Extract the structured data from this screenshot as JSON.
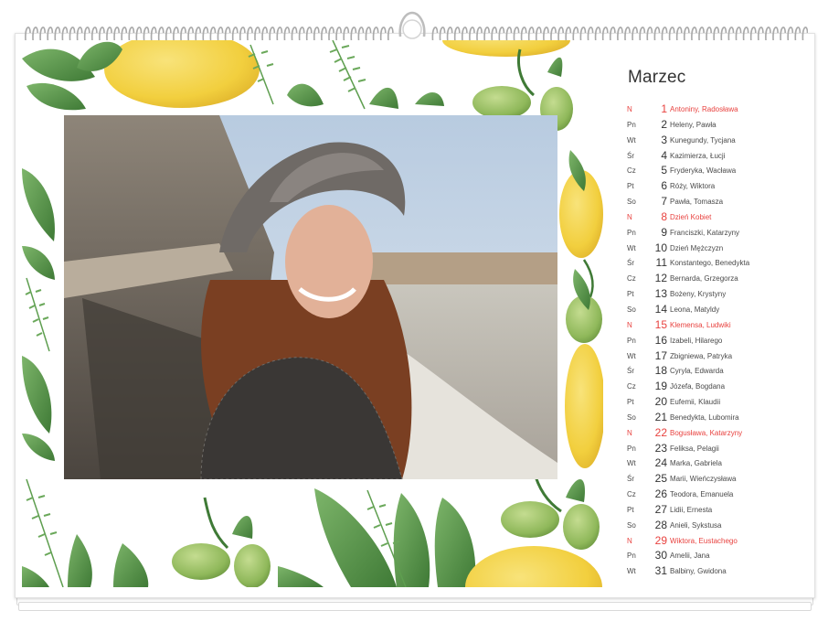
{
  "calendar": {
    "month": "Marzec",
    "colors": {
      "sunday": "#e8423f",
      "text": "#4a4a4a"
    },
    "days": [
      {
        "dow": "N",
        "num": "1",
        "names": "Antoniny, Radosława",
        "sunday": true
      },
      {
        "dow": "Pn",
        "num": "2",
        "names": "Heleny, Pawła",
        "sunday": false
      },
      {
        "dow": "Wt",
        "num": "3",
        "names": "Kunegundy, Tycjana",
        "sunday": false
      },
      {
        "dow": "Śr",
        "num": "4",
        "names": "Kazimierza, Łucji",
        "sunday": false
      },
      {
        "dow": "Cz",
        "num": "5",
        "names": "Fryderyka, Wacława",
        "sunday": false
      },
      {
        "dow": "Pt",
        "num": "6",
        "names": "Róży, Wiktora",
        "sunday": false
      },
      {
        "dow": "So",
        "num": "7",
        "names": "Pawła, Tomasza",
        "sunday": false
      },
      {
        "dow": "N",
        "num": "8",
        "names": "Dzień Kobiet",
        "sunday": true
      },
      {
        "dow": "Pn",
        "num": "9",
        "names": "Franciszki, Katarzyny",
        "sunday": false
      },
      {
        "dow": "Wt",
        "num": "10",
        "names": "Dzień Mężczyzn",
        "sunday": false
      },
      {
        "dow": "Śr",
        "num": "11",
        "names": "Konstantego, Benedykta",
        "sunday": false
      },
      {
        "dow": "Cz",
        "num": "12",
        "names": "Bernarda, Grzegorza",
        "sunday": false
      },
      {
        "dow": "Pt",
        "num": "13",
        "names": "Bożeny, Krystyny",
        "sunday": false
      },
      {
        "dow": "So",
        "num": "14",
        "names": "Leona, Matyldy",
        "sunday": false
      },
      {
        "dow": "N",
        "num": "15",
        "names": "Klemensa, Ludwiki",
        "sunday": true
      },
      {
        "dow": "Pn",
        "num": "16",
        "names": "Izabeli, Hilarego",
        "sunday": false
      },
      {
        "dow": "Wt",
        "num": "17",
        "names": "Zbigniewa, Patryka",
        "sunday": false
      },
      {
        "dow": "Śr",
        "num": "18",
        "names": "Cyryla, Edwarda",
        "sunday": false
      },
      {
        "dow": "Cz",
        "num": "19",
        "names": "Józefa, Bogdana",
        "sunday": false
      },
      {
        "dow": "Pt",
        "num": "20",
        "names": "Eufemii, Klaudii",
        "sunday": false
      },
      {
        "dow": "So",
        "num": "21",
        "names": "Benedykta, Lubomira",
        "sunday": false
      },
      {
        "dow": "N",
        "num": "22",
        "names": "Bogusława, Katarzyny",
        "sunday": true
      },
      {
        "dow": "Pn",
        "num": "23",
        "names": "Feliksa, Pelagii",
        "sunday": false
      },
      {
        "dow": "Wt",
        "num": "24",
        "names": "Marka, Gabriela",
        "sunday": false
      },
      {
        "dow": "Śr",
        "num": "25",
        "names": "Marii, Wieńczysława",
        "sunday": false
      },
      {
        "dow": "Cz",
        "num": "26",
        "names": "Teodora, Emanuela",
        "sunday": false
      },
      {
        "dow": "Pt",
        "num": "27",
        "names": "Lidii, Ernesta",
        "sunday": false
      },
      {
        "dow": "So",
        "num": "28",
        "names": "Anieli, Sykstusa",
        "sunday": false
      },
      {
        "dow": "N",
        "num": "29",
        "names": "Wiktora, Eustachego",
        "sunday": true
      },
      {
        "dow": "Pn",
        "num": "30",
        "names": "Amelii, Jana",
        "sunday": false
      },
      {
        "dow": "Wt",
        "num": "31",
        "names": "Balbiny, Gwidona",
        "sunday": false
      }
    ]
  },
  "artwork": {
    "colors": {
      "leaf": "#5e9e4f",
      "leaf_dark": "#3f7a36",
      "lemon": "#f2cf3e",
      "olive": "#8fb85a"
    },
    "icons": [
      "lemon-icon",
      "olive-icon",
      "leaf-icon",
      "rosemary-icon"
    ]
  }
}
